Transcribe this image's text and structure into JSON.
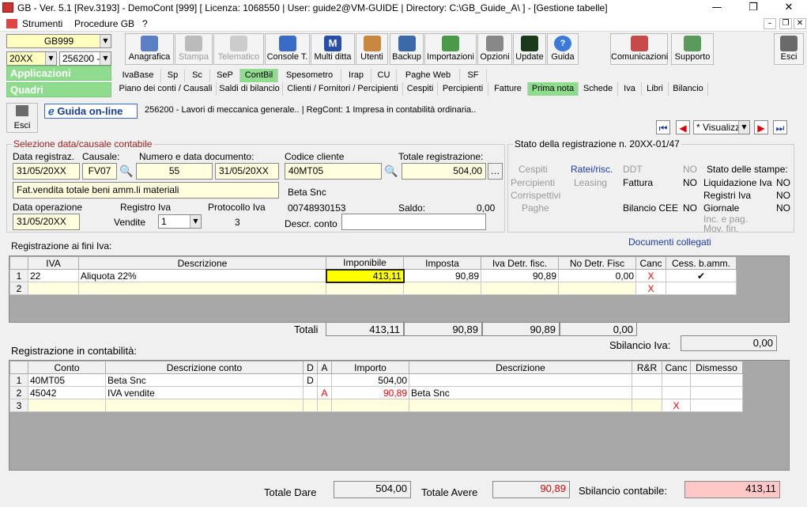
{
  "window": {
    "title": "GB - Ver. 5.1 [Rev.3193] -  DemoCont [999]     [ Licenza: 1068550 | User: guide2@VM-GUIDE | Directory: C:\\GB_Guide_A\\ ] - [Gestione tabelle]",
    "min": "—",
    "max": "❐",
    "close": "✕"
  },
  "menu": {
    "items": [
      "Strumenti",
      "Procedure GB",
      "?"
    ]
  },
  "selectors": {
    "company": "GB999",
    "year": "20XX",
    "code": "256200 -",
    "app": "Applicazioni",
    "quadri": "Quadri"
  },
  "toolbar": {
    "buttons": [
      "Anagrafica",
      "Stampa",
      "Telematico",
      "Console T.",
      "Multi ditta",
      "Utenti",
      "Backup",
      "Importazioni",
      "Opzioni",
      "Update",
      "Guida",
      "Comunicazioni",
      "Supporto"
    ],
    "esci": "Esci"
  },
  "tabs1": [
    "IvaBase",
    "Sp",
    "Sc",
    "SeP",
    "ContBil",
    "Spesometro",
    "Irap",
    "CU",
    "Paghe Web",
    "SF"
  ],
  "tabs2": [
    "Piano dei conti / Causali",
    "Saldi di bilancio",
    "Clienti / Fornitori / Percipienti",
    "Cespiti",
    "Percipienti",
    "Fatture",
    "Prima nota",
    "Schede",
    "Iva",
    "Libri",
    "Bilancio"
  ],
  "header": {
    "esci": "Esci",
    "guida": "Guida on-line",
    "info": "256200 - Lavori di meccanica generale..  | RegCont: 1 Impresa  in contabilità ordinaria..",
    "visualizza": "* Visualizz"
  },
  "sel": {
    "legend": "Selezione data/causale contabile",
    "data_reg_label": "Data registraz.",
    "causale_label": "Causale:",
    "numdoc_label": "Numero e data documento:",
    "data_reg": "31/05/20XX",
    "causale": "FV07",
    "numero": "55",
    "data_doc": "31/05/20XX",
    "descr": "Fat.vendita totale beni amm.li materiali",
    "data_op_label": "Data operazione",
    "data_op": "31/05/20XX",
    "registro_label": "Registro Iva",
    "registro_val": "Vendite",
    "registro_num": "1",
    "protocollo_label": "Protocollo Iva",
    "protocollo": "3",
    "codcli_label": "Codice cliente",
    "codcli": "40MT05",
    "totreg_label": "Totale registrazione:",
    "totreg": "504,00",
    "cliname": "Beta Snc",
    "piva": "00748930153",
    "saldo_label": "Saldo:",
    "saldo": "0,00",
    "descr_conto_label": "Descr. conto"
  },
  "stato": {
    "legend": "Stato della registrazione n. 20XX-01/47",
    "cespiti": "Cespiti",
    "ratei": "Ratei/risc.",
    "ddt": "DDT",
    "no1": "NO",
    "percipienti": "Percipienti",
    "leasing": "Leasing",
    "fattura": "Fattura",
    "no2": "NO",
    "corrispettivi": "Corrispettivi",
    "paghe": "Paghe",
    "bilcee": "Bilancio CEE",
    "no3": "NO",
    "stampe": "Stato delle stampe:",
    "liq": "Liquidazione Iva",
    "liqv": "NO",
    "reg": "Registri Iva",
    "regv": "NO",
    "gio": "Giornale",
    "giov": "NO",
    "inc": "Inc. e pag.",
    "mov": "Mov. fin."
  },
  "iva": {
    "title": "Registrazione ai fini Iva:",
    "docs": "Documenti collegati",
    "headers": [
      "IVA",
      "Descrizione",
      "Imponibile",
      "Imposta",
      "Iva Detr. fisc.",
      "No Detr. Fisc",
      "Canc",
      "Cess. b.amm."
    ],
    "rows": [
      {
        "n": "1",
        "iva": "22",
        "descr": "Aliquota 22%",
        "imp": "413,11",
        "imposta": "90,89",
        "detr": "90,89",
        "nodetr": "0,00",
        "canc": "X",
        "cess": "✔"
      },
      {
        "n": "2",
        "iva": "",
        "descr": "",
        "imp": "",
        "imposta": "",
        "detr": "",
        "nodetr": "",
        "canc": "X",
        "cess": ""
      }
    ],
    "tot_label": "Totali",
    "tot_imp": "413,11",
    "tot_imposta": "90,89",
    "tot_detr": "90,89",
    "tot_nodetr": "0,00",
    "sbil_label": "Sbilancio Iva:",
    "sbil": "0,00"
  },
  "cont": {
    "title": "Registrazione in contabilità:",
    "headers": [
      "Conto",
      "Descrizione conto",
      "D",
      "A",
      "Importo",
      "Descrizione",
      "R&R",
      "Canc",
      "Dismesso"
    ],
    "rows": [
      {
        "n": "1",
        "conto": "40MT05",
        "descr": "Beta Snc",
        "d": "D",
        "a": "",
        "imp": "504,00",
        "desc2": "",
        "canc": ""
      },
      {
        "n": "2",
        "conto": "45042",
        "descr": "IVA vendite",
        "d": "",
        "a": "A",
        "imp": "90,89",
        "desc2": "Beta Snc",
        "canc": ""
      },
      {
        "n": "3",
        "conto": "",
        "descr": "",
        "d": "",
        "a": "",
        "imp": "",
        "desc2": "",
        "canc": "X"
      }
    ],
    "dare_label": "Totale Dare",
    "dare": "504,00",
    "avere_label": "Totale Avere",
    "avere": "90,89",
    "sbil_label": "Sbilancio contabile:",
    "sbil": "413,11"
  },
  "colors": {
    "accent": "#8fdc8f",
    "red": "#e00000",
    "yellow": "#ffff00",
    "pink": "#ffc8c8"
  }
}
